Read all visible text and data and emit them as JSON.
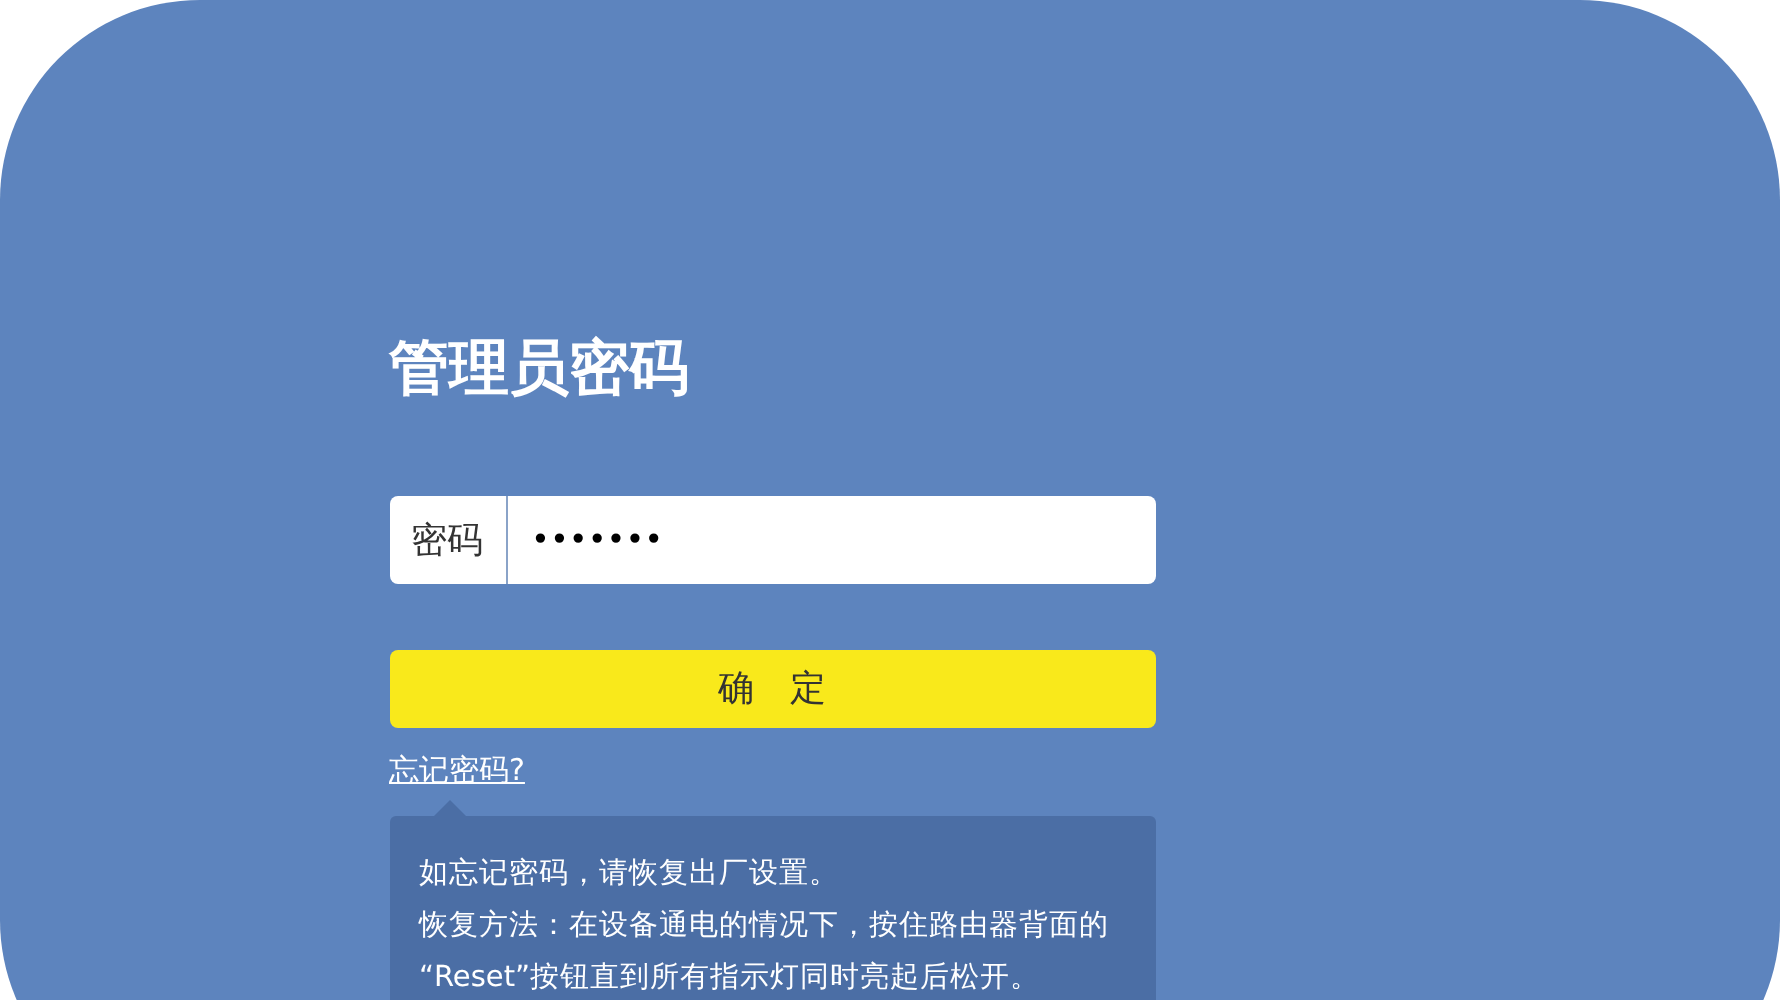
{
  "title": "管理员密码",
  "password_field": {
    "label": "密码",
    "value": "•••••••"
  },
  "confirm_button": {
    "label": "确　定"
  },
  "forgot_link": {
    "label": "忘记密码?",
    "expanded": true
  },
  "help_tooltip": {
    "lines": [
      "如忘记密码，请恢复出厂设置。",
      "恢复方法：在设备通电的情况下，按住路由器背面的 “Reset”按钮直到所有指示灯同时亮起后松开。"
    ]
  }
}
